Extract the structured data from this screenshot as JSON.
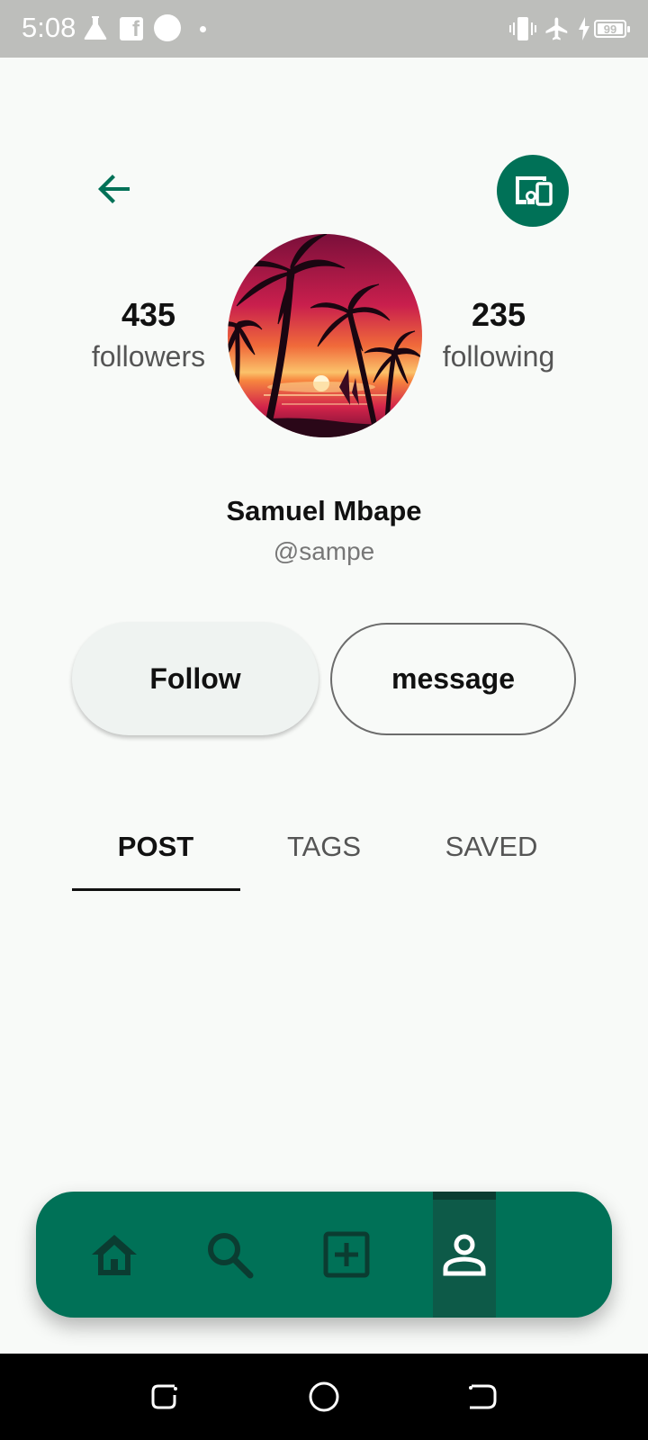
{
  "status_bar": {
    "time": "5:08",
    "battery": "99",
    "icons": [
      "flask-icon",
      "facebook-icon",
      "circle-icon",
      "dot-icon",
      "vibrate-icon",
      "airplane-icon",
      "charging-icon",
      "battery-icon"
    ]
  },
  "header": {
    "back_icon": "arrow-back-icon",
    "devices_icon": "devices-icon"
  },
  "profile": {
    "followers_count": "435",
    "followers_label": "followers",
    "following_count": "235",
    "following_label": "following",
    "name": "Samuel Mbape",
    "handle": "@sampe",
    "avatar": "sunset-palm-trees-image"
  },
  "actions": {
    "follow_label": "Follow",
    "message_label": "message"
  },
  "tabs": [
    {
      "label": "POST",
      "active": true
    },
    {
      "label": "TAGS",
      "active": false
    },
    {
      "label": "SAVED",
      "active": false
    }
  ],
  "bottom_nav": {
    "items": [
      {
        "icon": "home-icon",
        "active": false
      },
      {
        "icon": "search-icon",
        "active": false
      },
      {
        "icon": "add-box-icon",
        "active": false
      },
      {
        "icon": "person-icon",
        "active": true
      }
    ]
  },
  "colors": {
    "primary": "#007157",
    "background": "#f8faf8",
    "status_bar": "#bdbebb",
    "inactive_icon": "#0b3c31",
    "text": "#111111"
  }
}
